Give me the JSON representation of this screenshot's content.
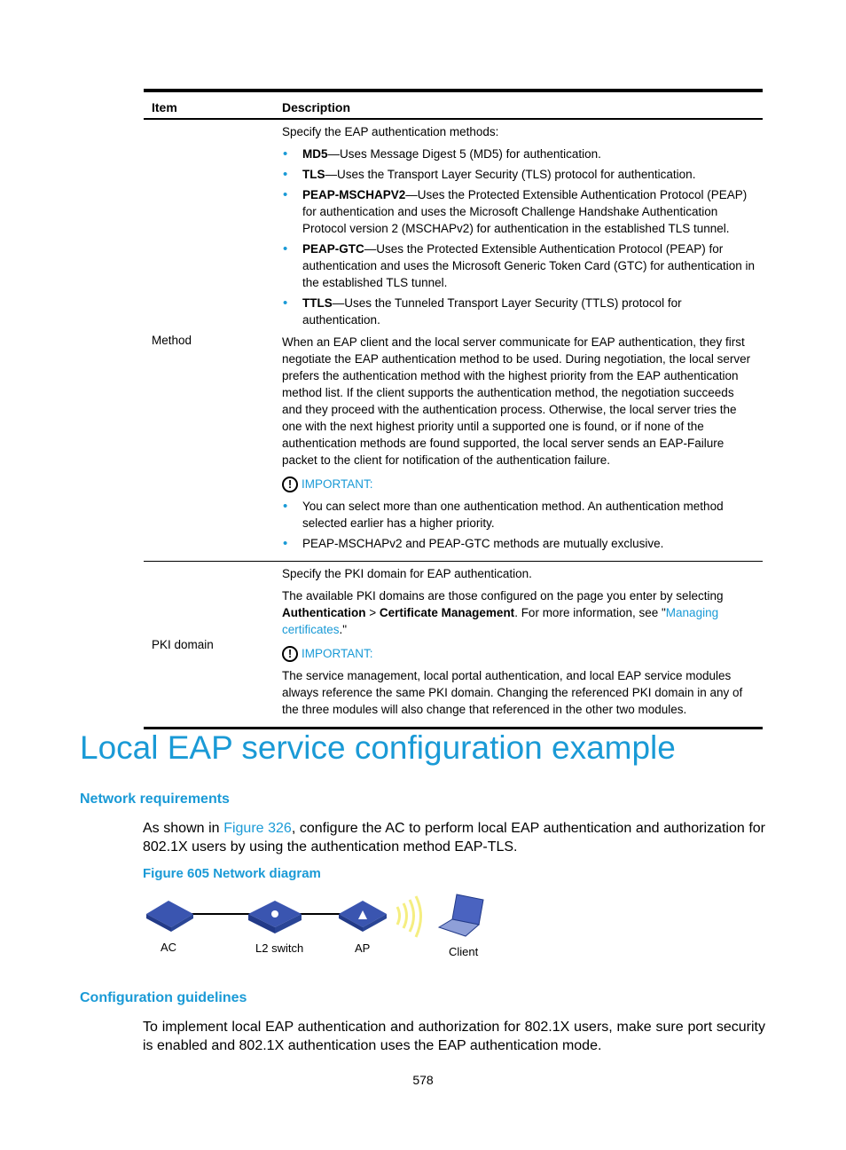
{
  "table": {
    "headers": {
      "item": "Item",
      "description": "Description"
    },
    "method": {
      "item": "Method",
      "intro": "Specify the EAP authentication methods:",
      "bullets": [
        {
          "term": "MD5",
          "text": "—Uses Message Digest 5 (MD5) for authentication."
        },
        {
          "term": "TLS",
          "text": "—Uses the Transport Layer Security (TLS) protocol for authentication."
        },
        {
          "term": "PEAP-MSCHAPV2",
          "text": "—Uses the Protected Extensible Authentication Protocol (PEAP) for authentication and uses the Microsoft Challenge Handshake Authentication Protocol version 2 (MSCHAPv2) for authentication in the established TLS tunnel."
        },
        {
          "term": "PEAP-GTC",
          "text": "—Uses the Protected Extensible Authentication Protocol (PEAP) for authentication and uses the Microsoft Generic Token Card (GTC) for authentication in the established TLS tunnel."
        },
        {
          "term": "TTLS",
          "text": "—Uses the Tunneled Transport Layer Security (TTLS) protocol for authentication."
        }
      ],
      "paragraph": "When an EAP client and the local server communicate for EAP authentication, they first negotiate the EAP authentication method to be used. During negotiation, the local server prefers the authentication method with the highest priority from the EAP authentication method list. If the client supports the authentication method, the negotiation succeeds and they proceed with the authentication process. Otherwise, the local server tries the one with the next highest priority until a supported one is found, or if none of the authentication methods are found supported, the local server sends an EAP-Failure packet to the client for notification of the authentication failure.",
      "important_label": "IMPORTANT:",
      "important_bullets": [
        "You can select more than one authentication method. An authentication method selected earlier has a higher priority.",
        "PEAP-MSCHAPv2 and PEAP-GTC methods are mutually exclusive."
      ]
    },
    "pki": {
      "item": "PKI domain",
      "intro": "Specify the PKI domain for EAP authentication.",
      "p2_a": "The available PKI domains are those configured on the page you enter by selecting ",
      "p2_b1": "Authentication",
      "p2_sep": " > ",
      "p2_b2": "Certificate Management",
      "p2_c": ". For more information, see \"",
      "p2_link": "Managing certificates",
      "p2_d": ".\"",
      "important_label": "IMPORTANT:",
      "important_text": "The service management, local portal authentication, and local EAP service modules always reference the same PKI domain. Changing the referenced PKI domain in any of the three modules will also change that referenced in the other two modules."
    }
  },
  "section_title": "Local EAP service configuration example",
  "network_requirements": {
    "heading": "Network requirements",
    "text_a": "As shown in ",
    "link": "Figure 326",
    "text_b": ", configure the AC to perform local EAP authentication and authorization for 802.1X users by using the authentication method EAP-TLS.",
    "figure_caption": "Figure 605 Network diagram",
    "diagram_labels": {
      "ac": "AC",
      "switch": "L2 switch",
      "ap": "AP",
      "client": "Client"
    }
  },
  "configuration_guidelines": {
    "heading": "Configuration guidelines",
    "text": "To implement local EAP authentication and authorization for 802.1X users, make sure port security is enabled and 802.1X authentication uses the EAP authentication mode."
  },
  "page_number": "578"
}
